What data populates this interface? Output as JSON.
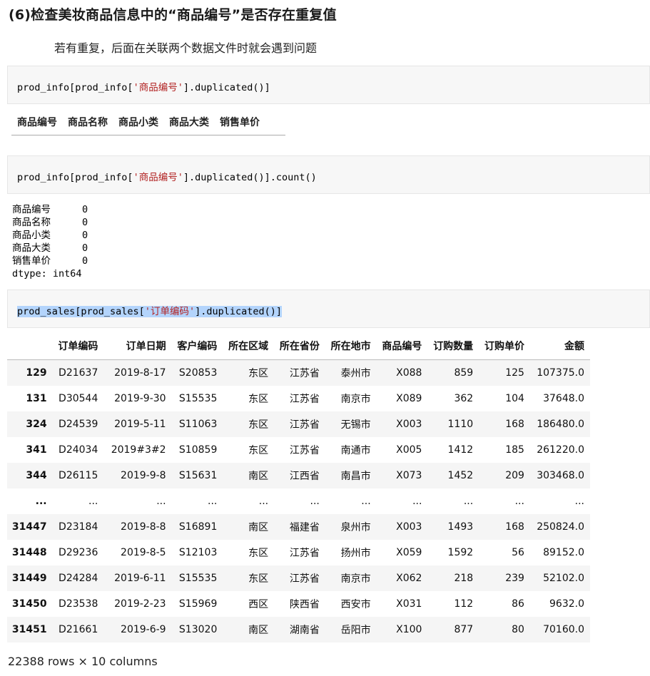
{
  "heading": "(6)检查美妆商品信息中的“商品编号”是否存在重复值",
  "paragraph": "若有重复，后面在关联两个数据文件时就会遇到问题",
  "cell1": {
    "pre": "prod_info[prod_info[",
    "str": "'商品编号'",
    "post": "].duplicated()]"
  },
  "empty_df_headers": [
    "商品编号",
    "商品名称",
    "商品小类",
    "商品大类",
    "销售单价"
  ],
  "cell2": {
    "pre": "prod_info[prod_info[",
    "str": "'商品编号'",
    "post": "].duplicated()].count()"
  },
  "series_output": {
    "rows": [
      {
        "key": "商品编号",
        "value": "0"
      },
      {
        "key": "商品名称",
        "value": "0"
      },
      {
        "key": "商品小类",
        "value": "0"
      },
      {
        "key": "商品大类",
        "value": "0"
      },
      {
        "key": "销售单价",
        "value": "0"
      }
    ],
    "dtype": "dtype: int64"
  },
  "cell3": {
    "pre": "prod_sales[prod_sales[",
    "str": "'订单编码'",
    "post": "].duplicated()]"
  },
  "table": {
    "columns": [
      "",
      "订单编码",
      "订单日期",
      "客户编码",
      "所在区域",
      "所在省份",
      "所在地市",
      "商品编号",
      "订购数量",
      "订购单价",
      "金额"
    ],
    "rows": [
      [
        "129",
        "D21637",
        "2019-8-17",
        "S20853",
        "东区",
        "江苏省",
        "泰州市",
        "X088",
        "859",
        "125",
        "107375.0"
      ],
      [
        "131",
        "D30544",
        "2019-9-30",
        "S15535",
        "东区",
        "江苏省",
        "南京市",
        "X089",
        "362",
        "104",
        "37648.0"
      ],
      [
        "324",
        "D24539",
        "2019-5-11",
        "S11063",
        "东区",
        "江苏省",
        "无锡市",
        "X003",
        "1110",
        "168",
        "186480.0"
      ],
      [
        "341",
        "D24034",
        "2019#3#2",
        "S10859",
        "东区",
        "江苏省",
        "南通市",
        "X005",
        "1412",
        "185",
        "261220.0"
      ],
      [
        "344",
        "D26115",
        "2019-9-8",
        "S15631",
        "南区",
        "江西省",
        "南昌市",
        "X073",
        "1452",
        "209",
        "303468.0"
      ],
      [
        "...",
        "...",
        "...",
        "...",
        "...",
        "...",
        "...",
        "...",
        "...",
        "...",
        "..."
      ],
      [
        "31447",
        "D23184",
        "2019-8-8",
        "S16891",
        "南区",
        "福建省",
        "泉州市",
        "X003",
        "1493",
        "168",
        "250824.0"
      ],
      [
        "31448",
        "D29236",
        "2019-8-5",
        "S12103",
        "东区",
        "江苏省",
        "扬州市",
        "X059",
        "1592",
        "56",
        "89152.0"
      ],
      [
        "31449",
        "D24284",
        "2019-6-11",
        "S15535",
        "东区",
        "江苏省",
        "南京市",
        "X062",
        "218",
        "239",
        "52102.0"
      ],
      [
        "31450",
        "D23538",
        "2019-2-23",
        "S15969",
        "西区",
        "陕西省",
        "西安市",
        "X031",
        "112",
        "86",
        "9632.0"
      ],
      [
        "31451",
        "D21661",
        "2019-6-9",
        "S13020",
        "南区",
        "湖南省",
        "岳阳市",
        "X100",
        "877",
        "80",
        "70160.0"
      ]
    ]
  },
  "footer": "22388 rows × 10 columns"
}
